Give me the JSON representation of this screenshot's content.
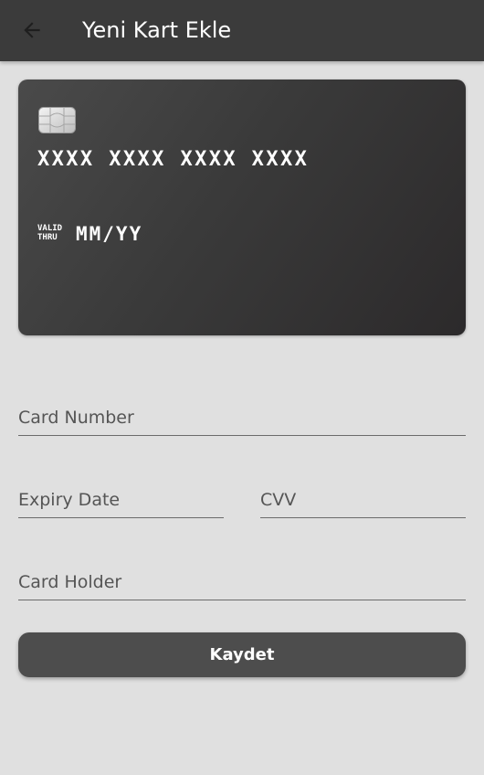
{
  "appbar": {
    "back_icon": "arrow-left-icon",
    "title": "Yeni Kart Ekle",
    "background": "#3b3b3b"
  },
  "card_preview": {
    "chip_icon": "sim-chip-icon",
    "number": "XXXX XXXX XXXX XXXX",
    "valid_thru_line1": "VALID",
    "valid_thru_line2": "THRU",
    "expiry": "MM/YY"
  },
  "form": {
    "card_number": {
      "placeholder": "Card Number",
      "value": ""
    },
    "expiry_date": {
      "placeholder": "Expiry Date",
      "value": ""
    },
    "cvv": {
      "placeholder": "CVV",
      "value": ""
    },
    "card_holder": {
      "placeholder": "Card Holder",
      "value": ""
    }
  },
  "actions": {
    "save_label": "Kaydet",
    "save_color": "#4d4d4d"
  }
}
